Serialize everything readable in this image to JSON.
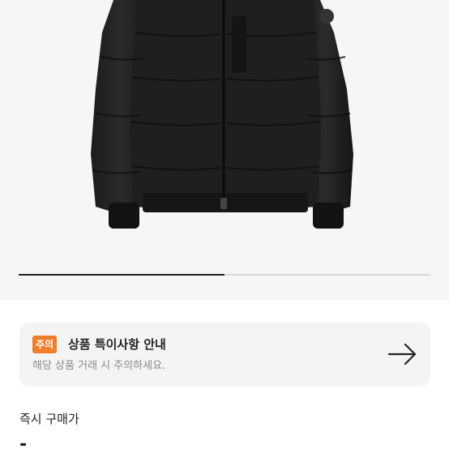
{
  "gallery": {
    "progress": 0.5
  },
  "notice": {
    "badge": "주의",
    "title": "상품 특이사항 안내",
    "subtitle": "해당 상품 거래 시 주의하세요.",
    "arrow_icon": "arrow-right-icon",
    "badge_color": "#ef7d2c"
  },
  "price": {
    "label": "즉시 구매가",
    "value": "-"
  }
}
